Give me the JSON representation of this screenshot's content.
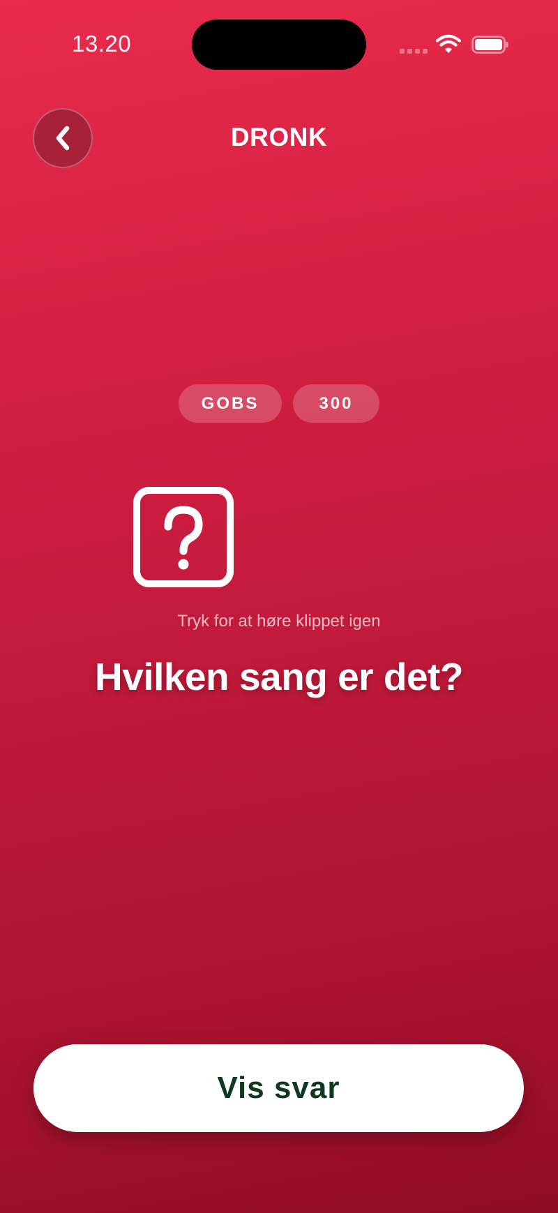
{
  "status_bar": {
    "time": "13.20"
  },
  "header": {
    "title": "DRONK"
  },
  "tags": [
    "GOBS",
    "300"
  ],
  "replay": {
    "hint": "Tryk for at høre klippet igen"
  },
  "question": "Hvilken sang er det?",
  "reveal_button": {
    "label": "Vis svar"
  },
  "colors": {
    "background_top": "#e92b4c",
    "background_bottom": "#8f0c24",
    "button_text": "#0f3820"
  }
}
